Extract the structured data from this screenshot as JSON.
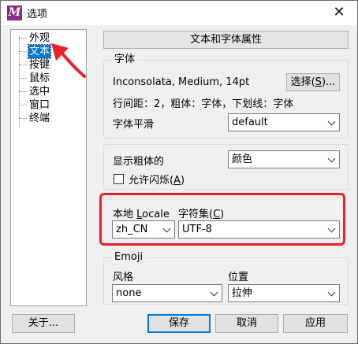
{
  "window": {
    "app_icon_letter": "M",
    "title": "选项",
    "close_glyph": "✕",
    "app_icon_color": "#8a2d86"
  },
  "tree": {
    "items": [
      "外观",
      "文本",
      "按键",
      "鼠标",
      "选中",
      "窗口",
      "终端"
    ],
    "selected_index": 1
  },
  "header": {
    "label": "文本和字体属性"
  },
  "font_group": {
    "legend": "字体",
    "font_info": "Inconsolata, Medium, 14pt",
    "choose_button_prefix": "选择(",
    "choose_button_key": "S",
    "choose_button_suffix": ")...",
    "details": "行间距：2，粗体：字体，下划线：字体",
    "smoothing_label": "字体平滑",
    "smoothing_value": "default"
  },
  "bold_group": {
    "show_bold_label": "显示粗体的",
    "show_bold_value": "颜色",
    "allow_blink_prefix": "允许闪烁(",
    "allow_blink_key": "A",
    "allow_blink_suffix": ")",
    "allow_blink_checked": false
  },
  "locale_group": {
    "locale_label_prefix": "本地 ",
    "locale_label_key": "L",
    "locale_label_suffix": "ocale",
    "locale_value": "zh_CN",
    "charset_label_prefix": "字符集(",
    "charset_label_key": "C",
    "charset_label_suffix": ")",
    "charset_value": "UTF-8",
    "highlight_color": "#e8212a"
  },
  "emoji_group": {
    "legend": "Emoji",
    "style_label": "风格",
    "style_value": "none",
    "position_label": "位置",
    "position_value": "拉伸"
  },
  "footer": {
    "about": "关于...",
    "save": "保存",
    "cancel": "取消",
    "apply": "应用"
  }
}
